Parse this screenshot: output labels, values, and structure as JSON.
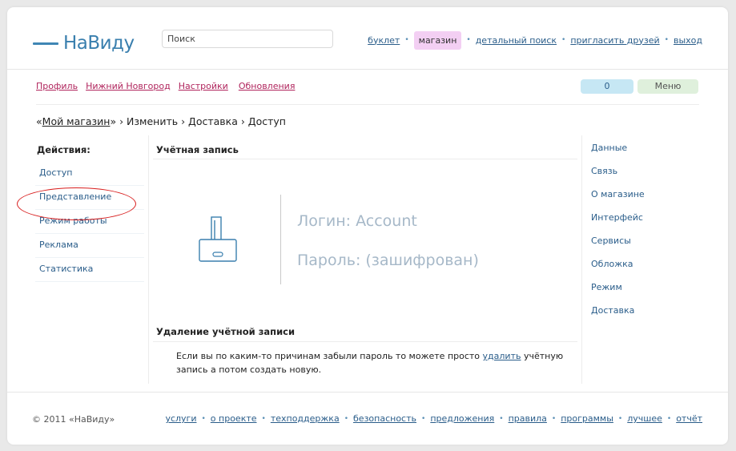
{
  "header": {
    "logo_text": "НаВиду",
    "search_placeholder": "Поиск",
    "nav": {
      "booklet": "буклет",
      "shop": "магазин",
      "detail_search": "детальный поиск",
      "invite": "пригласить друзей",
      "logout": "выход",
      "separator": "•"
    }
  },
  "subnav": {
    "profile": "Профиль",
    "city": "Нижний Новгород",
    "settings": "Настройки",
    "updates": "Обновления",
    "count": "0",
    "menu": "Меню"
  },
  "breadcrumb": {
    "quote_open": "«",
    "shop": "Мой магазин",
    "rest": "» › Изменить › Доставка › Доступ"
  },
  "left": {
    "title": "Действия:",
    "items": [
      "Доступ",
      "Представление",
      "Режим работы",
      "Реклама",
      "Статистика"
    ]
  },
  "account": {
    "title": "Учётная запись",
    "login": "Логин: Account",
    "password": "Пароль: (зашифрован)"
  },
  "delete": {
    "title": "Удаление учётной записи",
    "text_before": "Если вы по каким-то причинам забыли пароль то можете просто ",
    "link": "удалить",
    "text_after": " учётную запись а потом создать новую."
  },
  "right": {
    "items": [
      "Данные",
      "Связь",
      "О магазине",
      "Интерфейс",
      "Сервисы",
      "Обложка",
      "Режим",
      "Доставка"
    ]
  },
  "footer": {
    "copyright": "© 2011 «НаВиду»",
    "links": [
      "услуги",
      "о проекте",
      "техподдержка",
      "безопасность",
      "предложения",
      "правила",
      "программы",
      "лучшее",
      "отчёт"
    ],
    "separator": "•"
  },
  "colors": {
    "accent": "#3a7fae",
    "link": "#2a5d8a",
    "subnav_link": "#b0245c",
    "shop_highlight": "#f3cff3",
    "count_pill": "#c6e7f4",
    "menu_pill": "#dff0dc",
    "annotation_ellipse": "#d81e1e",
    "muted_text": "#a6b8c8"
  },
  "icons": {
    "account": "key-card-icon"
  }
}
